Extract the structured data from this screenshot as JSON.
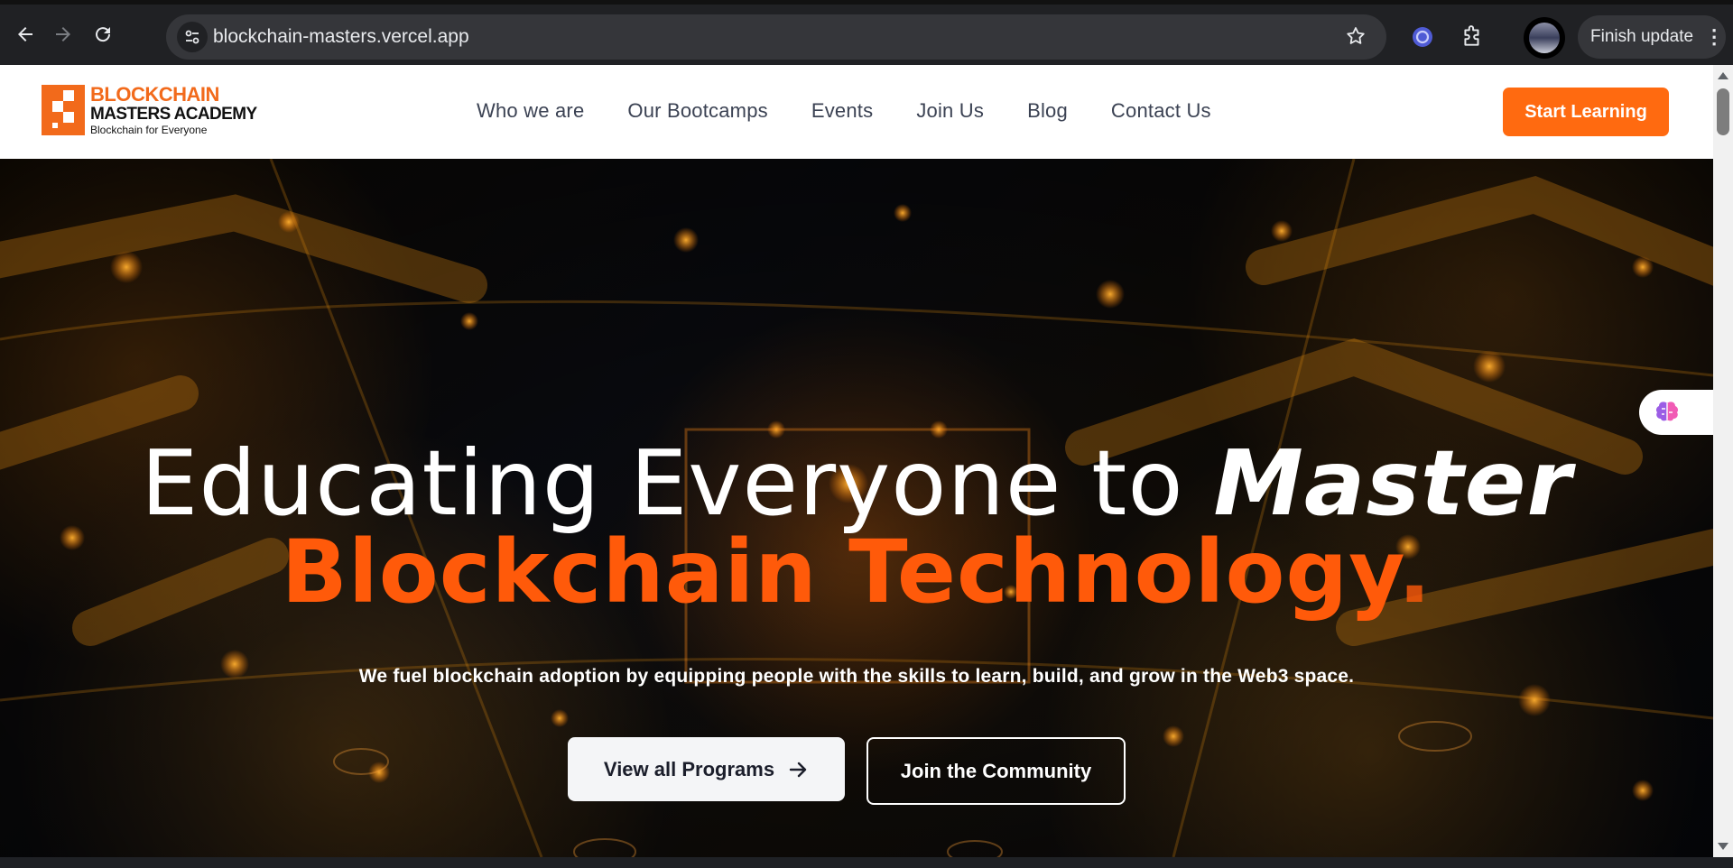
{
  "browser": {
    "url": "blockchain-masters.vercel.app",
    "finish_update_label": "Finish update",
    "icons": {
      "back": "arrow-left-icon",
      "forward": "arrow-right-icon",
      "reload": "reload-icon",
      "site_info": "tune-icon",
      "bookmark": "star-icon",
      "extension_1": "extension-circle-icon",
      "extensions": "puzzle-icon",
      "profile": "avatar",
      "menu": "kebab-menu-icon"
    }
  },
  "header": {
    "logo": {
      "line1": "BLOCKCHAIN",
      "line2": "MASTERS ACADEMY",
      "tagline": "Blockchain for Everyone"
    },
    "nav": [
      {
        "label": "Who we are"
      },
      {
        "label": "Our Bootcamps"
      },
      {
        "label": "Events"
      },
      {
        "label": "Join Us"
      },
      {
        "label": "Blog"
      },
      {
        "label": "Contact Us"
      }
    ],
    "cta_label": "Start Learning"
  },
  "hero": {
    "title_part1": "Educating Everyone to ",
    "title_emphasis": "Master",
    "title_line2": "Blockchain Technology",
    "title_period": ".",
    "subtitle": "We fuel blockchain adoption by equipping people with the skills to learn, build, and grow in the Web3 space.",
    "primary_button": "View all Programs",
    "secondary_button": "Join the Community"
  },
  "colors": {
    "accent": "#ff6a10",
    "heading_accent": "#ff5a0a",
    "nav_text": "#3b4253",
    "chrome_bg": "#202124"
  }
}
